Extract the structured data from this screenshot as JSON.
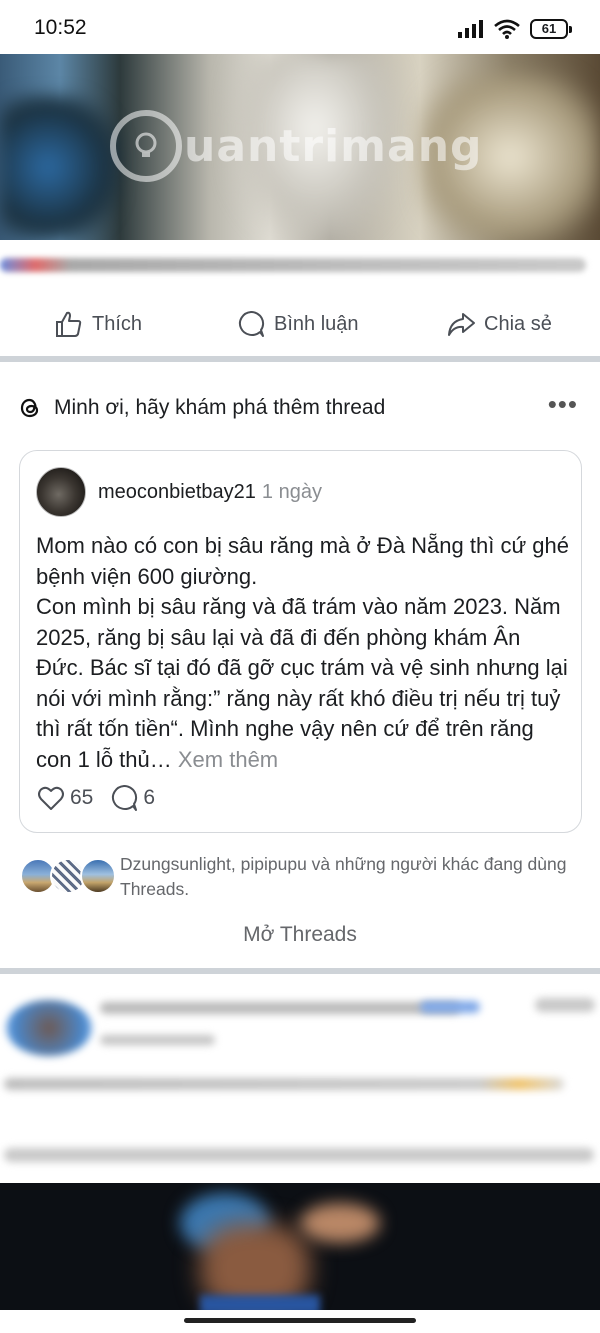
{
  "status_bar": {
    "time": "10:52",
    "battery": "61"
  },
  "top_post": {
    "watermark": "uantrimang",
    "actions": {
      "like": "Thích",
      "comment": "Bình luận",
      "share": "Chia sẻ"
    }
  },
  "threads": {
    "header_title": "Minh ơi, hãy khám phá thêm thread",
    "card": {
      "username": "meoconbietbay21",
      "time_ago": "1 ngày",
      "body": "Mom nào có con bị sâu răng mà ở Đà Nẵng thì cứ ghé bệnh viện 600 giường.\nCon mình bị sâu răng và đã trám vào năm 2023. Năm 2025, răng bị sâu lại và đã đi đến phòng khám Ân Đức. Bác sĩ tại đó đã gỡ cục trám và vệ sinh nhưng lại nói với mình rằng:” răng này rất khó điều trị nếu trị tuỷ thì rất tốn tiền“. Mình nghe vậy nên cứ để trên răng con 1 lỗ thủ…",
      "see_more": "Xem thêm",
      "likes": "65",
      "comments": "6"
    },
    "social_proof": "Dzungsunlight, pipipupu và những người khác đang dùng Threads.",
    "open_button": "Mở Threads"
  },
  "colors": {
    "divider": "#ced3d8",
    "secondary_text": "#65676b",
    "card_border": "#d5d8dc"
  }
}
